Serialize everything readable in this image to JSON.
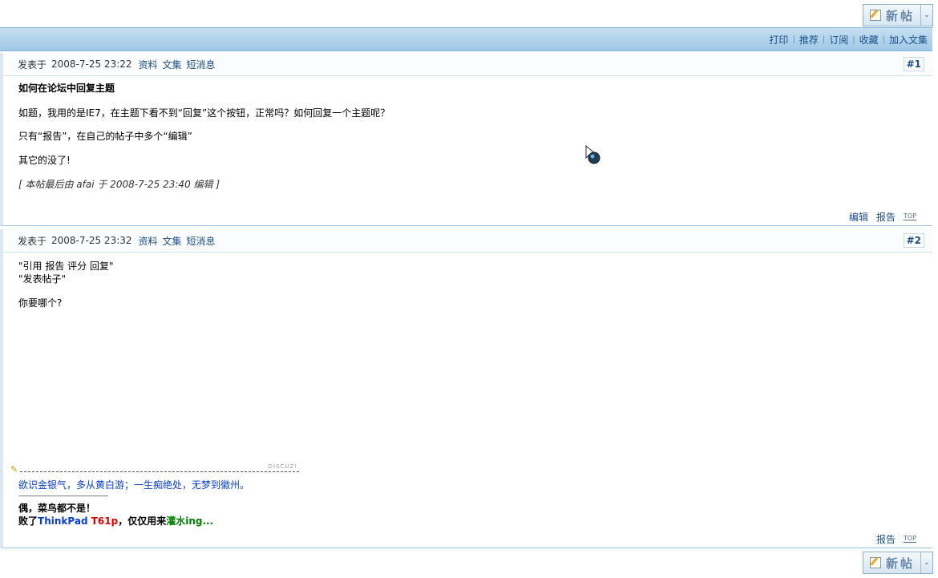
{
  "newpost": {
    "label": "新帖",
    "arrow": "⌄"
  },
  "toolbar": {
    "items": [
      "打印",
      "推荐",
      "订阅",
      "收藏",
      "加入文集"
    ]
  },
  "posts": [
    {
      "posted_label": "发表于",
      "time": "2008-7-25 23:22",
      "links": [
        "资料",
        "文集",
        "短消息"
      ],
      "floor": "#1",
      "title": "如何在论坛中回复主题",
      "lines": [
        "如题，我用的是IE7，在主题下看不到“回复”这个按钮，正常吗？如何回复一个主题呢？",
        "只有“报告”，在自己的帖子中多个“编辑”",
        "其它的没了!"
      ],
      "edit_note": "[ 本帖最后由 afai 于 2008-7-25 23:40 编辑 ]",
      "footer": [
        "编辑",
        "报告"
      ],
      "top_label": "TOP"
    },
    {
      "posted_label": "发表于",
      "time": "2008-7-25 23:32",
      "links": [
        "资料",
        "文集",
        "短消息"
      ],
      "floor": "#2",
      "lines": [
        "\"引用  报告  评分  回复\"",
        "\"发表帖子\"",
        "你要哪个?"
      ],
      "sig_brand": "DISCUZ!",
      "sig_line": "欲识金银气，多从黄白游；一生痴绝处，无梦到徽州。",
      "sig_dashes": "-----------------------------------------------------------",
      "sig_bold1": "偶，菜鸟都不是！",
      "sig_bold2_a": "败了",
      "sig_bold2_b": "ThinkPad",
      "sig_bold2_c": "T61p",
      "sig_bold2_d": "，仅仅用来",
      "sig_bold2_e": "灌水ing...",
      "footer": [
        "报告"
      ],
      "top_label": "TOP"
    }
  ],
  "colors": {
    "link": "#1a4f8a",
    "toolbar": "#a9cfe9",
    "sig_blue": "#0a3fd6",
    "sig_red": "#e00000",
    "sig_green": "#008000"
  }
}
